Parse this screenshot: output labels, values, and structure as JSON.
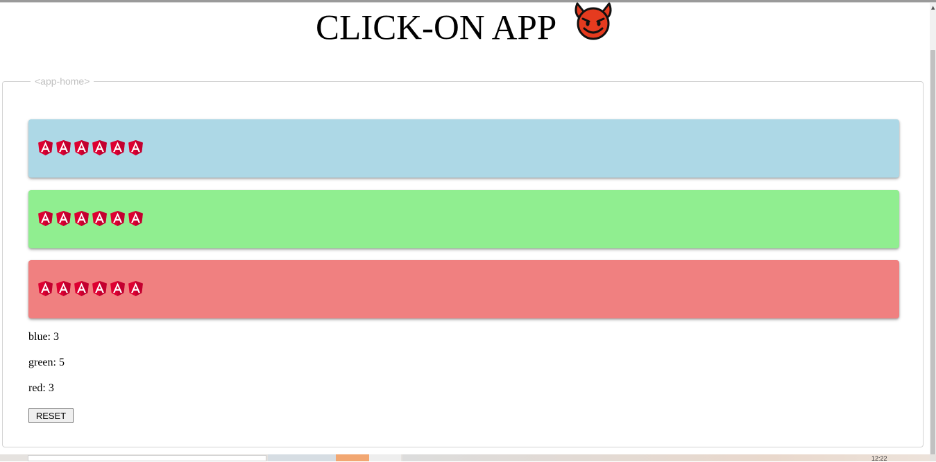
{
  "header": {
    "title": "CLICK-ON APP",
    "icon": "smiling-devil-emoji"
  },
  "component": {
    "tag": "<app-home>"
  },
  "panels": [
    {
      "color_name": "blue",
      "color": "#add8e6",
      "icon": "angular-logo-icon",
      "icon_count": 6
    },
    {
      "color_name": "green",
      "color": "#90ee90",
      "icon": "angular-logo-icon",
      "icon_count": 6
    },
    {
      "color_name": "red",
      "color": "#f08080",
      "icon": "angular-logo-icon",
      "icon_count": 6
    }
  ],
  "counters": [
    {
      "label": "blue: 3"
    },
    {
      "label": "green: 5"
    },
    {
      "label": "red: 3"
    }
  ],
  "reset_button": {
    "label": "RESET"
  },
  "colors": {
    "angular_red": "#dd0031",
    "angular_dark": "#c3002f"
  },
  "taskbar": {
    "clock": "12:22"
  }
}
